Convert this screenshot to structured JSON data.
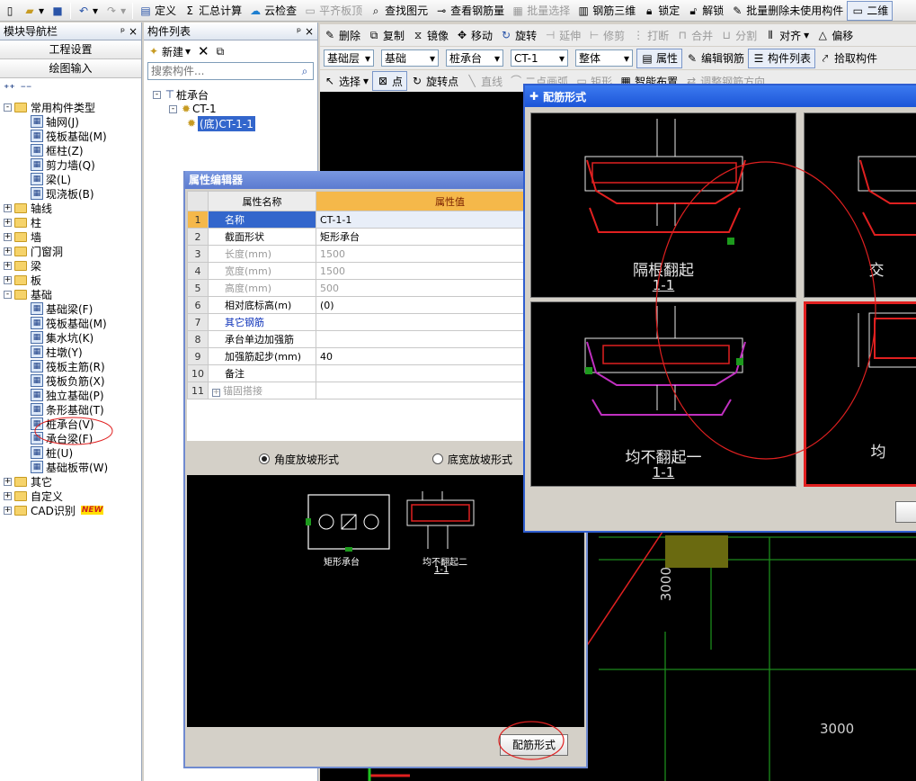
{
  "toolbar1": {
    "items": [
      {
        "label": "定义",
        "icon": "define-icon"
      },
      {
        "label": "汇总计算",
        "icon": "sum-icon"
      },
      {
        "label": "云检查",
        "icon": "cloud-check-icon"
      },
      {
        "label": "平齐板顶",
        "icon": "align-top-icon"
      },
      {
        "label": "查找图元",
        "icon": "find-icon"
      },
      {
        "label": "查看钢筋量",
        "icon": "rebar-view-icon"
      },
      {
        "label": "批量选择",
        "icon": "batch-select-icon"
      },
      {
        "label": "钢筋三维",
        "icon": "rebar-3d-icon"
      },
      {
        "label": "锁定",
        "icon": "lock-icon"
      },
      {
        "label": "解锁",
        "icon": "unlock-icon"
      },
      {
        "label": "批量删除未使用构件",
        "icon": "batch-delete-icon"
      },
      {
        "label": "二维",
        "icon": "2d-icon"
      }
    ]
  },
  "toolbar2": {
    "items": [
      "删除",
      "复制",
      "镜像",
      "移动",
      "旋转",
      "延伸",
      "修剪",
      "打断",
      "合并",
      "分割",
      "对齐",
      "偏移"
    ]
  },
  "toolbar3": {
    "combos": [
      "基础层",
      "基础",
      "桩承台",
      "CT-1",
      "整体"
    ],
    "buttons": [
      "属性",
      "编辑钢筋",
      "构件列表",
      "拾取构件"
    ]
  },
  "toolbar4": {
    "items": [
      "选择",
      "点",
      "旋转点",
      "直线",
      "二点画弧",
      "矩形",
      "智能布置",
      "调整钢筋方向"
    ]
  },
  "nav": {
    "title": "模块导航栏",
    "pin": "ᵖ ×",
    "btn_project": "工程设置",
    "btn_draw": "绘图输入",
    "tree": [
      {
        "label": "常用构件类型",
        "level": 0,
        "type": "folder",
        "exp": "-"
      },
      {
        "label": "轴网(J)",
        "level": 1,
        "type": "comp"
      },
      {
        "label": "筏板基础(M)",
        "level": 1,
        "type": "comp"
      },
      {
        "label": "框柱(Z)",
        "level": 1,
        "type": "comp"
      },
      {
        "label": "剪力墙(Q)",
        "level": 1,
        "type": "comp"
      },
      {
        "label": "梁(L)",
        "level": 1,
        "type": "comp"
      },
      {
        "label": "现浇板(B)",
        "level": 1,
        "type": "comp"
      },
      {
        "label": "轴线",
        "level": 0,
        "type": "folder",
        "exp": "+"
      },
      {
        "label": "柱",
        "level": 0,
        "type": "folder",
        "exp": "+"
      },
      {
        "label": "墙",
        "level": 0,
        "type": "folder",
        "exp": "+"
      },
      {
        "label": "门窗洞",
        "level": 0,
        "type": "folder",
        "exp": "+"
      },
      {
        "label": "梁",
        "level": 0,
        "type": "folder",
        "exp": "+"
      },
      {
        "label": "板",
        "level": 0,
        "type": "folder",
        "exp": "+"
      },
      {
        "label": "基础",
        "level": 0,
        "type": "folder",
        "exp": "-"
      },
      {
        "label": "基础梁(F)",
        "level": 1,
        "type": "comp"
      },
      {
        "label": "筏板基础(M)",
        "level": 1,
        "type": "comp"
      },
      {
        "label": "集水坑(K)",
        "level": 1,
        "type": "comp"
      },
      {
        "label": "柱墩(Y)",
        "level": 1,
        "type": "comp"
      },
      {
        "label": "筏板主筋(R)",
        "level": 1,
        "type": "comp"
      },
      {
        "label": "筏板负筋(X)",
        "level": 1,
        "type": "comp"
      },
      {
        "label": "独立基础(P)",
        "level": 1,
        "type": "comp"
      },
      {
        "label": "条形基础(T)",
        "level": 1,
        "type": "comp"
      },
      {
        "label": "桩承台(V)",
        "level": 1,
        "type": "comp"
      },
      {
        "label": "承台梁(F)",
        "level": 1,
        "type": "comp"
      },
      {
        "label": "桩(U)",
        "level": 1,
        "type": "comp"
      },
      {
        "label": "基础板带(W)",
        "level": 1,
        "type": "comp"
      },
      {
        "label": "其它",
        "level": 0,
        "type": "folder",
        "exp": "+"
      },
      {
        "label": "自定义",
        "level": 0,
        "type": "folder",
        "exp": "+"
      },
      {
        "label": "CAD识别",
        "level": 0,
        "type": "folder",
        "exp": "+",
        "badge": "NEW"
      }
    ]
  },
  "complist": {
    "title": "构件列表",
    "pin": "ᵖ ×",
    "new_btn": "新建",
    "search_placeholder": "搜索构件...",
    "tree": [
      {
        "label": "桩承台",
        "level": 0
      },
      {
        "label": "CT-1",
        "level": 1
      },
      {
        "label": "(底)CT-1-1",
        "level": 2,
        "selected": true
      }
    ]
  },
  "props": {
    "title": "属性编辑器",
    "col_name": "属性名称",
    "col_value": "属性值",
    "rows": [
      {
        "n": "1",
        "name": "名称",
        "value": "CT-1-1",
        "style": "normal"
      },
      {
        "n": "2",
        "name": "截面形状",
        "value": "矩形承台",
        "style": "normal"
      },
      {
        "n": "3",
        "name": "长度(mm)",
        "value": "1500",
        "style": "dim"
      },
      {
        "n": "4",
        "name": "宽度(mm)",
        "value": "1500",
        "style": "dim"
      },
      {
        "n": "5",
        "name": "高度(mm)",
        "value": "500",
        "style": "dim"
      },
      {
        "n": "6",
        "name": "相对底标高(m)",
        "value": "(0)",
        "style": "normal"
      },
      {
        "n": "7",
        "name": "其它钢筋",
        "value": "",
        "style": "blue"
      },
      {
        "n": "8",
        "name": "承台单边加强筋",
        "value": "",
        "style": "normal"
      },
      {
        "n": "9",
        "name": "加强筋起步(mm)",
        "value": "40",
        "style": "normal"
      },
      {
        "n": "10",
        "name": "备注",
        "value": "",
        "style": "normal"
      },
      {
        "n": "11",
        "name": "锚固搭接",
        "value": "",
        "style": "dim",
        "expand": "+"
      }
    ],
    "radio1": "角度放坡形式",
    "radio2": "底宽放坡形式",
    "preview_label1": "矩形承台",
    "preview_label2": "均不翻起二",
    "preview_label3": "1-1",
    "btn_rebar": "配筋形式"
  },
  "dialog": {
    "title": "配筋形式",
    "options": [
      {
        "name": "隔根翻起",
        "sub": "1-1"
      },
      {
        "name": "交",
        "sub": ""
      },
      {
        "name": "均不翻起一",
        "sub": "1-1"
      },
      {
        "name": "均",
        "sub": ""
      }
    ]
  },
  "canvas": {
    "dim1": "3000",
    "dim2": "3000"
  }
}
